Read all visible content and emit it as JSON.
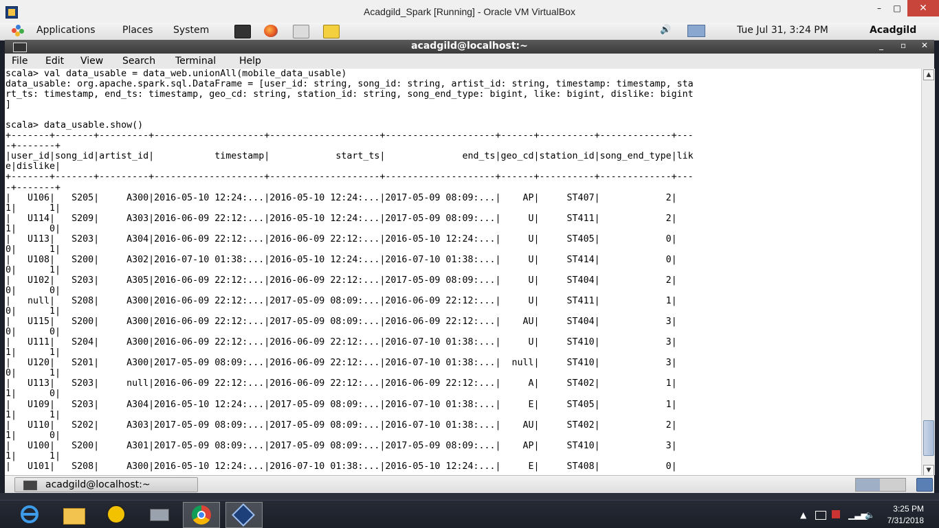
{
  "vbox_window": {
    "title": "Acadgild_Spark [Running] - Oracle VM VirtualBox",
    "minimize": "–",
    "maximize": "□",
    "close": "✕"
  },
  "gnome_panel": {
    "menus": [
      "Applications",
      "Places",
      "System"
    ],
    "launchers": [
      "terminal-icon",
      "firefox-icon",
      "mail-icon",
      "notes-icon"
    ],
    "datetime": "Tue Jul 31,  3:24 PM",
    "user": "Acadgild"
  },
  "terminal": {
    "title": "acadgild@localhost:~",
    "controls": {
      "minimize": "_",
      "maximize": "▫",
      "close": "✕"
    },
    "menus": [
      "File",
      "Edit",
      "View",
      "Search",
      "Terminal",
      "Help"
    ],
    "lines": [
      "scala> val data_usable = data_web.unionAll(mobile_data_usable)",
      "data_usable: org.apache.spark.sql.DataFrame = [user_id: string, song_id: string, artist_id: string, timestamp: timestamp, sta",
      "rt_ts: timestamp, end_ts: timestamp, geo_cd: string, station_id: string, song_end_type: bigint, like: bigint, dislike: bigint",
      "]",
      "",
      "scala> data_usable.show()",
      "+-------+-------+---------+--------------------+--------------------+--------------------+------+----------+-------------+---",
      "-+-------+",
      "|user_id|song_id|artist_id|           timestamp|            start_ts|              end_ts|geo_cd|station_id|song_end_type|lik",
      "e|dislike|",
      "+-------+-------+---------+--------------------+--------------------+--------------------+------+----------+-------------+---",
      "-+-------+",
      "|   U106|   S205|     A300|2016-05-10 12:24:...|2016-05-10 12:24:...|2017-05-09 08:09:...|    AP|     ST407|            2|",
      "1|      1|",
      "|   U114|   S209|     A303|2016-06-09 22:12:...|2016-05-10 12:24:...|2017-05-09 08:09:...|     U|     ST411|            2|",
      "1|      0|",
      "|   U113|   S203|     A304|2016-06-09 22:12:...|2016-06-09 22:12:...|2016-05-10 12:24:...|     U|     ST405|            0|",
      "0|      1|",
      "|   U108|   S200|     A302|2016-07-10 01:38:...|2016-05-10 12:24:...|2016-07-10 01:38:...|     U|     ST414|            0|",
      "0|      1|",
      "|   U102|   S203|     A305|2016-06-09 22:12:...|2016-06-09 22:12:...|2017-05-09 08:09:...|     U|     ST404|            2|",
      "0|      0|",
      "|   null|   S208|     A300|2016-06-09 22:12:...|2017-05-09 08:09:...|2016-06-09 22:12:...|     U|     ST411|            1|",
      "0|      1|",
      "|   U115|   S200|     A300|2016-06-09 22:12:...|2017-05-09 08:09:...|2016-06-09 22:12:...|    AU|     ST404|            3|",
      "0|      0|",
      "|   U111|   S204|     A300|2016-06-09 22:12:...|2016-06-09 22:12:...|2016-07-10 01:38:...|     U|     ST410|            3|",
      "1|      1|",
      "|   U120|   S201|     A300|2017-05-09 08:09:...|2016-06-09 22:12:...|2016-07-10 01:38:...|  null|     ST410|            3|",
      "0|      1|",
      "|   U113|   S203|     null|2016-06-09 22:12:...|2016-06-09 22:12:...|2016-06-09 22:12:...|     A|     ST402|            1|",
      "1|      0|",
      "|   U109|   S203|     A304|2016-05-10 12:24:...|2017-05-09 08:09:...|2016-07-10 01:38:...|     E|     ST405|            1|",
      "1|      1|",
      "|   U110|   S202|     A303|2017-05-09 08:09:...|2017-05-09 08:09:...|2016-07-10 01:38:...|    AU|     ST402|            2|",
      "1|      0|",
      "|   U100|   S200|     A301|2017-05-09 08:09:...|2017-05-09 08:09:...|2017-05-09 08:09:...|    AP|     ST410|            3|",
      "1|      1|",
      "|   U101|   S208|     A300|2016-05-10 12:24:...|2016-07-10 01:38:...|2016-05-10 12:24:...|     E|     ST408|            0|"
    ]
  },
  "bottom_panel": {
    "task_label": "acadgild@localhost:~"
  },
  "windows_taskbar": {
    "apps": [
      "internet-explorer-icon",
      "file-explorer-icon",
      "download-app-icon",
      "printer-icon",
      "chrome-icon",
      "virtualbox-icon"
    ],
    "clock_time": "3:25 PM",
    "clock_date": "7/31/2018"
  }
}
